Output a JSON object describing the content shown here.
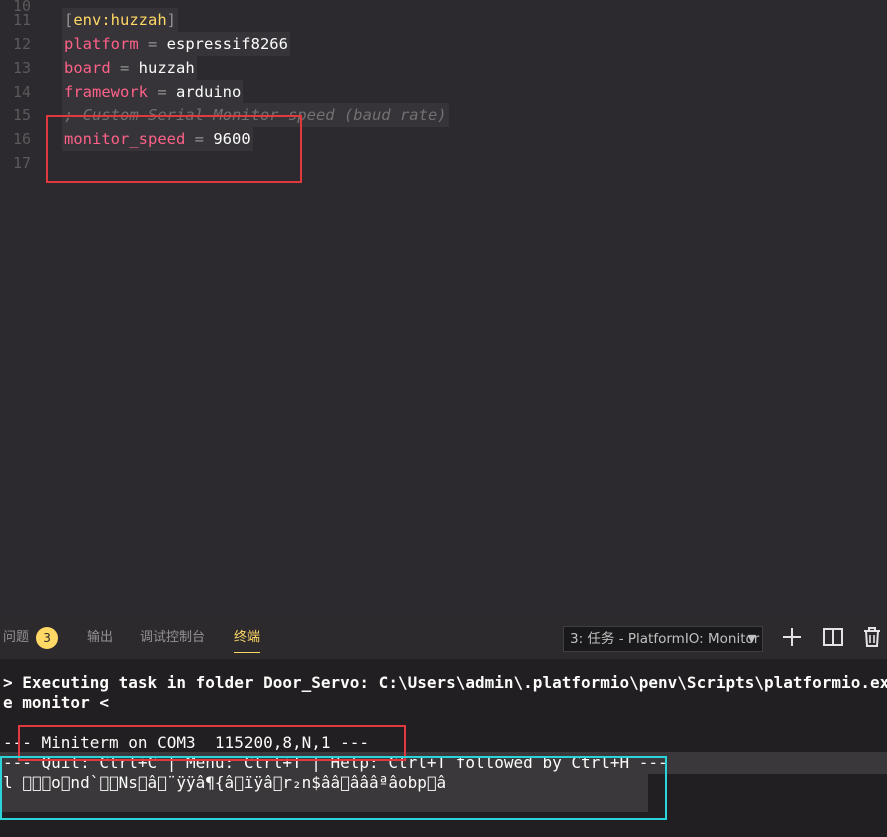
{
  "editor": {
    "lines": [
      {
        "num": "10",
        "parts": []
      },
      {
        "num": "11",
        "parts": [
          {
            "t": "[",
            "c": "brk"
          },
          {
            "t": "env:huzzah",
            "c": "sect"
          },
          {
            "t": "]",
            "c": "brk"
          }
        ]
      },
      {
        "num": "12",
        "parts": [
          {
            "t": "platform",
            "c": "key"
          },
          {
            "t": " = ",
            "c": "op"
          },
          {
            "t": "espressif8266",
            "c": "val"
          }
        ]
      },
      {
        "num": "13",
        "parts": [
          {
            "t": "board",
            "c": "key"
          },
          {
            "t": " = ",
            "c": "op"
          },
          {
            "t": "huzzah",
            "c": "val"
          }
        ]
      },
      {
        "num": "14",
        "parts": [
          {
            "t": "framework",
            "c": "key"
          },
          {
            "t": " = ",
            "c": "op"
          },
          {
            "t": "arduino",
            "c": "val"
          }
        ]
      },
      {
        "num": "15",
        "parts": [
          {
            "t": "; Custom Serial Monitor speed (baud rate)",
            "c": "comment"
          }
        ]
      },
      {
        "num": "16",
        "parts": [
          {
            "t": "monitor_speed",
            "c": "key"
          },
          {
            "t": " = ",
            "c": "op"
          },
          {
            "t": "9600",
            "c": "val"
          }
        ]
      },
      {
        "num": "17",
        "parts": []
      }
    ]
  },
  "panel": {
    "tabs": [
      {
        "label": "问题",
        "badge": "3",
        "active": false
      },
      {
        "label": "输出",
        "active": false
      },
      {
        "label": "调试控制台",
        "active": false
      },
      {
        "label": "终端",
        "active": true
      }
    ],
    "terminal_select": "3: 任务 - PlatformIO: Monitor",
    "icons": [
      "plus-icon",
      "split-icon",
      "trash-icon"
    ]
  },
  "terminal": {
    "line1": "> Executing task in folder Door_Servo: C:\\Users\\admin\\.platformio\\penv\\Scripts\\platformio.exe device monitor <",
    "line1a": "> Executing task in folder Door_Servo: C:\\Users\\admin\\.platformio\\penv\\Scripts\\platformio.ex",
    "line1b": "e monitor <",
    "miniterm": "--- Miniterm on COM3  115200,8,N,1 ---",
    "help": "--- Quit: Ctrl+C | Menu: Ctrl+T | Help: Ctrl+T followed by Ctrl+H ---",
    "garbage": "l \u0000\u0002\u0010o\u0013nd`\u0003\u0012Ns\u0000â¨ÿÿâ¶{âïÿâ\u0003r₂n$ââ\u0002âââªâobp\u0000â"
  },
  "colors": {
    "accent_yellow": "#ffd866",
    "key_pink": "#ff6188",
    "annotation_red": "#e0393e",
    "annotation_cyan": "#2ad4d8"
  }
}
